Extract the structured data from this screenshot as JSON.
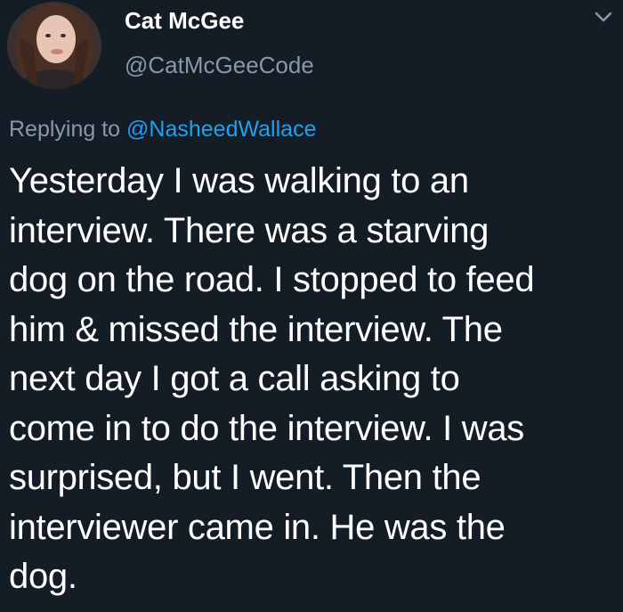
{
  "author": {
    "display_name": "Cat McGee",
    "handle": "@CatMcGeeCode"
  },
  "reply": {
    "prefix": "Replying to ",
    "mention": "@NasheedWallace"
  },
  "tweet": {
    "text": "Yesterday I was walking to an\ninterview. There was a starving\ndog on the road. I stopped to feed\nhim & missed the interview. The\nnext day I got a call asking to\ncome in to do the interview. I was\nsurprised, but I went. Then the\ninterviewer came in. He was the\ndog."
  },
  "icons": {
    "menu": "chevron-down-icon",
    "avatar": "avatar"
  },
  "colors": {
    "background": "#141c26",
    "secondary_text": "#8899a6",
    "link": "#1da1f2"
  }
}
